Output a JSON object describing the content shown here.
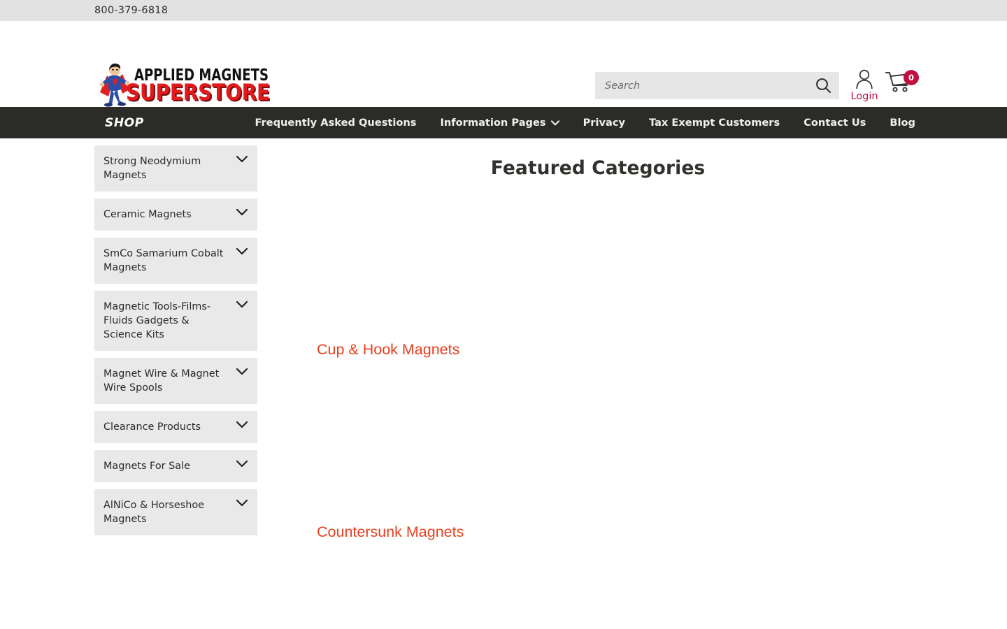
{
  "topbar": {
    "phone": "800-379-6818"
  },
  "header": {
    "logo": {
      "line1": "APPLIED MAGNETS",
      "line2": "SUPERSTORE",
      "icon": "superhero-mascot-icon"
    },
    "search": {
      "placeholder": "Search",
      "value": "",
      "button_icon": "search-icon"
    },
    "account": {
      "label": "Login",
      "icon": "user-icon"
    },
    "cart": {
      "count": "0",
      "icon": "shopping-cart-icon"
    }
  },
  "nav": {
    "shop_label": "SHOP",
    "links": [
      {
        "label": "Frequently Asked Questions",
        "has_caret": false
      },
      {
        "label": "Information Pages",
        "has_caret": true
      },
      {
        "label": "Privacy",
        "has_caret": false
      },
      {
        "label": "Tax Exempt Customers",
        "has_caret": false
      },
      {
        "label": "Contact Us",
        "has_caret": false
      },
      {
        "label": "Blog",
        "has_caret": false
      }
    ]
  },
  "sidebar": {
    "items": [
      {
        "label": "Strong Neodymium Magnets",
        "icon": "chevron-down-icon"
      },
      {
        "label": "Ceramic Magnets",
        "icon": "chevron-down-icon"
      },
      {
        "label": "SmCo Samarium Cobalt Magnets",
        "icon": "chevron-down-icon"
      },
      {
        "label": "Magnetic Tools-Films-Fluids Gadgets & Science Kits",
        "icon": "chevron-down-icon"
      },
      {
        "label": "Magnet Wire & Magnet Wire Spools",
        "icon": "chevron-down-icon"
      },
      {
        "label": "Clearance Products",
        "icon": "chevron-down-icon"
      },
      {
        "label": "Magnets For Sale",
        "icon": "chevron-down-icon"
      },
      {
        "label": "AlNiCo & Horseshoe Magnets",
        "icon": "chevron-down-icon"
      }
    ]
  },
  "main": {
    "title": "Featured Categories",
    "categories": [
      {
        "label": "Cup & Hook Magnets"
      },
      {
        "label": "Countersunk Magnets"
      }
    ]
  },
  "colors": {
    "accent_red": "#e8401f",
    "brand_crimson": "#c01040",
    "nav_dark": "#2b2b28",
    "panel_gray": "#e9e9e9",
    "topbar_gray": "#e2e2e2"
  }
}
